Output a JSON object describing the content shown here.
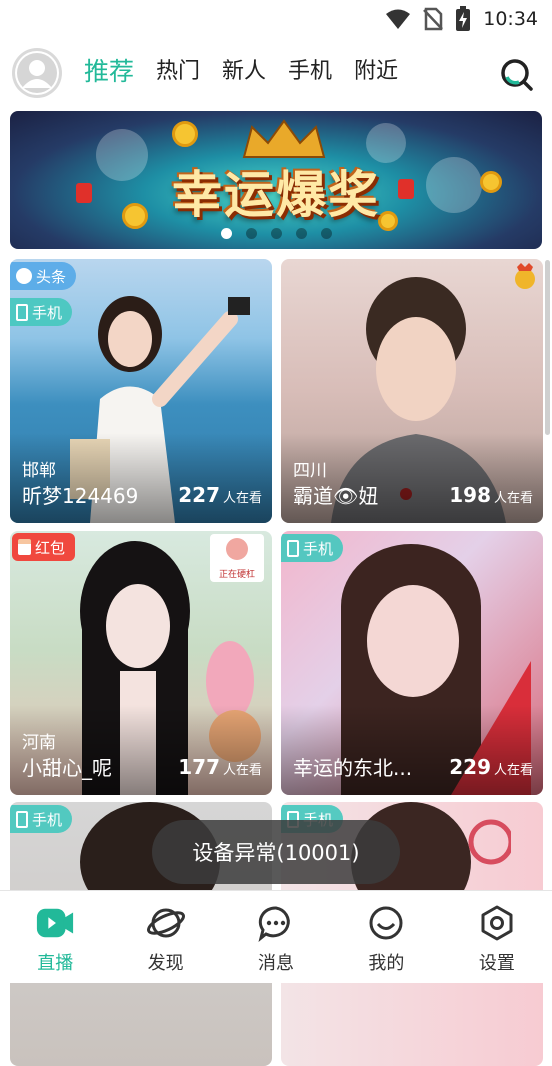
{
  "status": {
    "time": "10:34",
    "icons": [
      "wifi-icon",
      "no-sim-icon",
      "battery-charging-icon"
    ]
  },
  "header": {
    "tabs": [
      {
        "label": "推荐",
        "active": true
      },
      {
        "label": "热门"
      },
      {
        "label": "新人"
      },
      {
        "label": "手机"
      },
      {
        "label": "附近"
      }
    ],
    "icons": [
      "user-avatar-icon",
      "search-icon"
    ]
  },
  "banner": {
    "title": "幸运爆奖",
    "dots": 5,
    "active_dot": 0
  },
  "cards": [
    {
      "badge": "头条",
      "badge2": "手机",
      "location": "邯郸",
      "name": "昕梦124469",
      "viewers": "227",
      "unit": "人在看"
    },
    {
      "location": "四川",
      "name": "霸道👁妞",
      "viewers": "198",
      "unit": "人在看"
    },
    {
      "badge": "红包",
      "location": "河南",
      "name": "小甜心_呢",
      "viewers": "177",
      "unit": "人在看",
      "sticker": "正在硬杠"
    },
    {
      "badge": "手机",
      "location": "",
      "name": "幸运的东北...",
      "viewers": "229",
      "unit": "人在看"
    },
    {
      "badge": "手机"
    },
    {
      "badge": "手机"
    }
  ],
  "toast": "设备异常(10001)",
  "bottom_nav": [
    {
      "label": "直播",
      "icon": "live-video-icon",
      "active": true
    },
    {
      "label": "发现",
      "icon": "planet-icon"
    },
    {
      "label": "消息",
      "icon": "message-bubble-icon"
    },
    {
      "label": "我的",
      "icon": "smiley-face-icon"
    },
    {
      "label": "设置",
      "icon": "settings-hexagon-icon"
    }
  ],
  "colors": {
    "accent": "#22b999",
    "badge_red": "#f0483e",
    "badge_teal": "#46c8be"
  }
}
